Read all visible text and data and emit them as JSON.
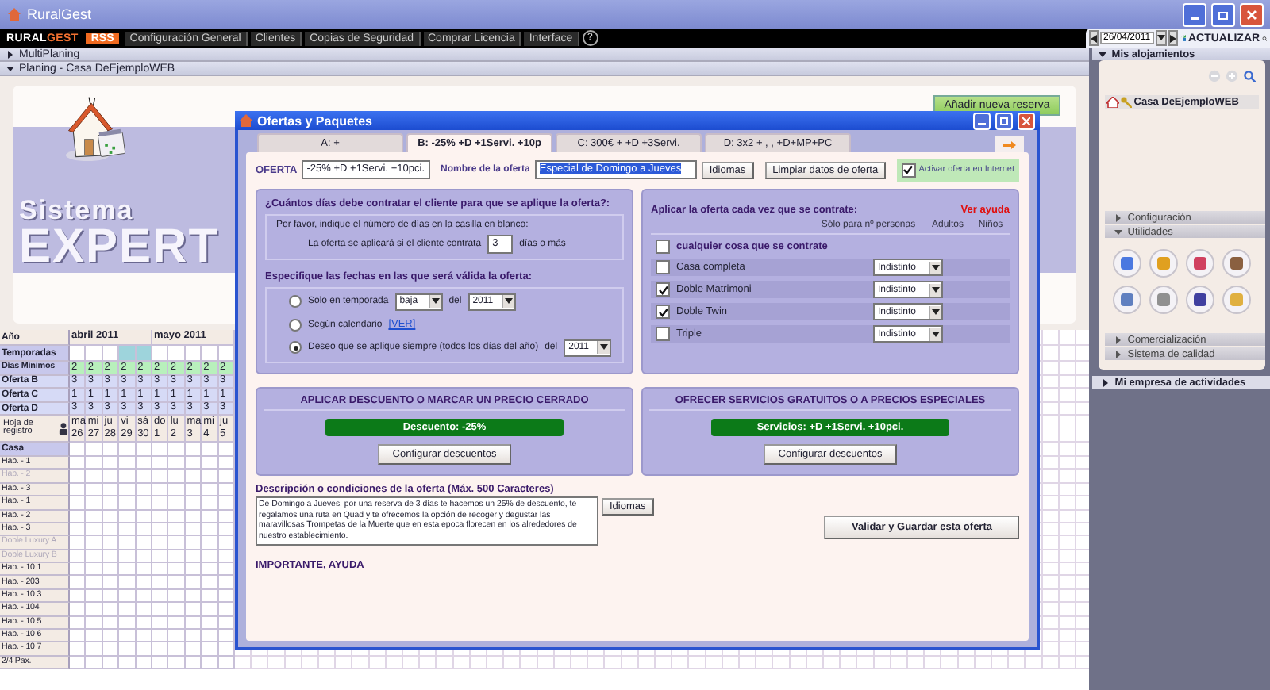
{
  "window": {
    "title": "RuralGest"
  },
  "menu": {
    "logo_left": "RURAL",
    "logo_right": "GEST",
    "rss": "RSS",
    "items": [
      "Configuración General",
      "Clientes",
      "Copias de Seguridad",
      "Comprar Licencia",
      "Interface"
    ],
    "help": "?"
  },
  "toolbar": {
    "date": "26/04/2011",
    "refresh": "ACTUALIZAR"
  },
  "sections": [
    {
      "label": "MultiPlaning",
      "expanded": false
    },
    {
      "label": "Planing - Casa DeEjemploWEB",
      "expanded": true
    }
  ],
  "banner": {
    "line_1": "Sistema",
    "line_2": "EXPERT",
    "add_button": "Añadir nueva reserva"
  },
  "planner": {
    "year_label": "Año",
    "season_label": "Temporadas",
    "register_label": "Hoja de registro",
    "house_label": "Casa",
    "months": [
      {
        "label": "abril  2011",
        "days": [
          {
            "weekday": "ma",
            "day": "26",
            "season": false
          },
          {
            "weekday": "mi",
            "day": "27",
            "season": false
          },
          {
            "weekday": "ju",
            "day": "28",
            "season": false
          },
          {
            "weekday": "vi",
            "day": "29",
            "season": true
          },
          {
            "weekday": "sá",
            "day": "30",
            "season": true
          }
        ]
      },
      {
        "label": "mayo  2011",
        "days": [
          {
            "weekday": "do",
            "day": "1",
            "season": false
          },
          {
            "weekday": "lu",
            "day": "2",
            "season": false
          },
          {
            "weekday": "ma",
            "day": "3",
            "season": false
          },
          {
            "weekday": "mi",
            "day": "4",
            "season": false
          },
          {
            "weekday": "ju",
            "day": "5",
            "season": false
          }
        ]
      }
    ],
    "rules": [
      {
        "kind": "minimum",
        "label": "Días Mínimos",
        "values": [
          "2",
          "2",
          "2",
          "2",
          "2",
          "2",
          "2",
          "2",
          "2",
          "2"
        ]
      },
      {
        "kind": "offer",
        "label": "Oferta B",
        "values": [
          "3",
          "3",
          "3",
          "3",
          "3",
          "3",
          "3",
          "3",
          "3",
          "3"
        ]
      },
      {
        "kind": "offer",
        "label": "Oferta C",
        "values": [
          "1",
          "1",
          "1",
          "1",
          "1",
          "1",
          "1",
          "1",
          "1",
          "1"
        ]
      },
      {
        "kind": "offer",
        "label": "Oferta D",
        "values": [
          "3",
          "3",
          "3",
          "3",
          "3",
          "3",
          "3",
          "3",
          "3",
          "3"
        ]
      }
    ],
    "rooms": [
      {
        "label": "Hab. - 1",
        "disabled": false
      },
      {
        "label": "Hab. - 2",
        "disabled": true
      },
      {
        "label": "Hab. - 3",
        "disabled": false
      },
      {
        "label": "Hab. - 1",
        "disabled": false
      },
      {
        "label": "Hab. - 2",
        "disabled": false
      },
      {
        "label": "Hab. - 3",
        "disabled": false
      },
      {
        "label": "Doble Luxury A",
        "disabled": true
      },
      {
        "label": "Doble Luxury B",
        "disabled": true
      },
      {
        "label": "Hab. - 10 1",
        "disabled": false
      },
      {
        "label": "Hab. - 203",
        "disabled": false
      },
      {
        "label": "Hab. - 10 3",
        "disabled": false
      },
      {
        "label": "Hab. - 104",
        "disabled": false
      },
      {
        "label": "Hab. - 10 5",
        "disabled": false
      },
      {
        "label": "Hab. - 10 6",
        "disabled": false
      },
      {
        "label": "Hab. - 10 7",
        "disabled": false
      },
      {
        "label": "2/4 Pax.",
        "disabled": false
      }
    ]
  },
  "dialog": {
    "title": "Ofertas y Paquetes",
    "tabs": [
      {
        "label": "A:  +",
        "selected": false
      },
      {
        "label": "B: -25% +D +1Servi. +10p",
        "selected": true
      },
      {
        "label": "C: 300€ + +D +3Servi.",
        "selected": false
      },
      {
        "label": "D: 3x2 + , , +D+MP+PC",
        "selected": false
      }
    ],
    "offer_label": "OFERTA",
    "offer_code": "-25% +D +1Servi. +10pci.",
    "name_label": "Nombre de la oferta",
    "name_value": "Especial de Domingo a Jueves",
    "languages_button": "Idiomas",
    "clear_button": "Limpiar datos de oferta",
    "publish": {
      "label": "Activar oferta en Internet",
      "checked": true
    },
    "days_panel": {
      "heading": "¿Cuántos días debe contratar el cliente para que se aplique la oferta?:",
      "hint": "Por favor, indique el número de días en la casilla en blanco:",
      "condition_before": "La oferta se aplicará si el cliente contrata",
      "days_value": "3",
      "condition_after": "días o más"
    },
    "dates_panel": {
      "heading": "Especifique las fechas en las que será válida la oferta:",
      "options": [
        {
          "kind": "season",
          "label": "Solo en temporada",
          "selected": false,
          "season": "baja",
          "of": "del",
          "year": "2011"
        },
        {
          "kind": "calendar",
          "label": "Según calendario",
          "selected": false,
          "link": "[VER]"
        },
        {
          "kind": "always",
          "label": "Deseo que se aplique siempre (todos los días del año)",
          "selected": true,
          "of": "del",
          "year": "2011"
        }
      ]
    },
    "apply_panel": {
      "heading": "Aplicar la oferta cada vez que se contrate:",
      "help_link": "Ver ayuda",
      "columns": [
        "Sólo para nº personas",
        "Adultos",
        "Niños"
      ],
      "any": {
        "label": "cualquier cosa que se contrate",
        "checked": false
      },
      "rooms": [
        {
          "label": "Casa completa",
          "checked": false,
          "persons": "Indistinto"
        },
        {
          "label": "Doble Matrimoni",
          "checked": true,
          "persons": "Indistinto"
        },
        {
          "label": "Doble Twin",
          "checked": true,
          "persons": "Indistinto"
        },
        {
          "label": "Triple",
          "checked": false,
          "persons": "Indistinto"
        }
      ]
    },
    "discount": {
      "heading": "APLICAR DESCUENTO O MARCAR UN PRECIO CERRADO",
      "summary": "Descuento: -25%",
      "button": "Configurar descuentos"
    },
    "services": {
      "heading": "OFRECER SERVICIOS GRATUITOS O A PRECIOS ESPECIALES",
      "summary": "Servicios: +D +1Servi. +10pci.",
      "button": "Configurar descuentos"
    },
    "description": {
      "label": "Descripción o condiciones de la oferta (Máx. 500 Caracteres)",
      "text": "De Domingo a Jueves, por una reserva de 3 días te hacemos un 25% de descuento, te regalamos una ruta en Quad y te ofrecemos la opción de recoger y degustar las maravillosas Trompetas de la Muerte que en esta epoca  florecen en los alrededores de nuestro establecimiento.",
      "languages_button": "Idiomas"
    },
    "save_button": "Validar y Guardar esta oferta",
    "help_link": "IMPORTANTE, AYUDA"
  },
  "sidebar": {
    "accommodations": {
      "heading": "Mis alojamientos",
      "expanded": true,
      "items": [
        {
          "label": "Casa DeEjemploWEB",
          "selected": true
        }
      ]
    },
    "sections": [
      {
        "label": "Configuración",
        "expanded": false
      },
      {
        "label": "Utilidades",
        "expanded": true
      },
      {
        "label": "Comercialización",
        "expanded": false
      },
      {
        "label": "Sistema de calidad",
        "expanded": false
      }
    ],
    "company": {
      "label": "Mi empresa de actividades",
      "expanded": false
    }
  }
}
